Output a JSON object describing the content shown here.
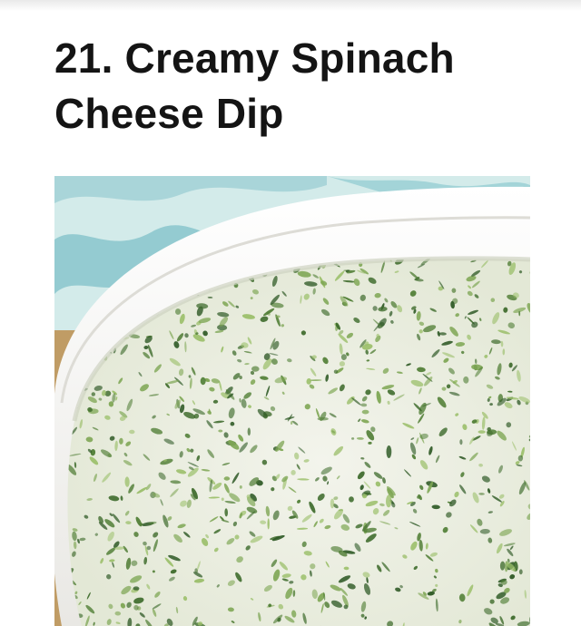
{
  "article": {
    "heading": "21. Creamy Spinach Cheese Dip"
  },
  "photo": {
    "icon": "spinach-dip-photo",
    "colors": {
      "background": "#d3ebea",
      "cloth_blue": "#7fc0c8",
      "bowl": "#f7f7f5",
      "dip": "#eef0e6",
      "spinach_dark": "#2f5a26",
      "spinach_light": "#7ea654",
      "wood": "#c8a56d"
    }
  }
}
